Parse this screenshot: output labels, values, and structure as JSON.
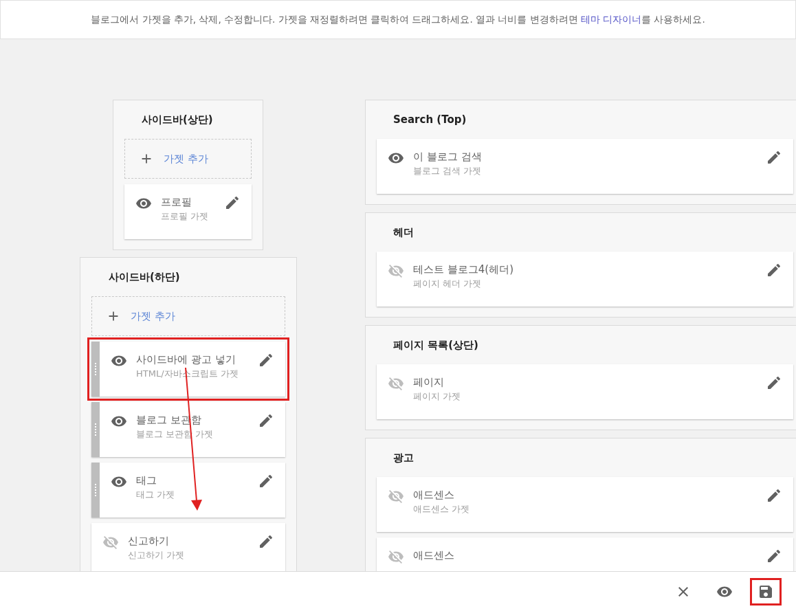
{
  "notice": {
    "before": "블로그에서 가젯을 추가, 삭제, 수정합니다. 가젯을 재정렬하려면 클릭하여 드래그하세요. 열과 너비를 변경하려면 ",
    "link": "테마 디자이너",
    "after": "를 사용하세요."
  },
  "left_column": [
    {
      "title": "사이드바(상단)",
      "add_label": "가젯 추가",
      "gadgets": [
        {
          "title": "프로필",
          "subtitle": "프로필 가젯",
          "visible": true,
          "draggable": false,
          "highlighted": false
        }
      ]
    },
    {
      "title": "사이드바(하단)",
      "add_label": "가젯 추가",
      "gadgets": [
        {
          "title": "사이드바에 광고 넣기",
          "subtitle": "HTML/자바스크립트 가젯",
          "visible": true,
          "draggable": true,
          "highlighted": true
        },
        {
          "title": "블로그 보관함",
          "subtitle": "블로그 보관함 가젯",
          "visible": true,
          "draggable": true,
          "highlighted": false
        },
        {
          "title": "태그",
          "subtitle": "태그 가젯",
          "visible": true,
          "draggable": true,
          "highlighted": false
        },
        {
          "title": "신고하기",
          "subtitle": "신고하기 가젯",
          "visible": false,
          "draggable": false,
          "highlighted": false
        }
      ]
    }
  ],
  "right_column": [
    {
      "title": "Search (Top)",
      "gadgets": [
        {
          "title": "이 블로그 검색",
          "subtitle": "블로그 검색 가젯",
          "visible": true,
          "draggable": false,
          "highlighted": false
        }
      ]
    },
    {
      "title": "헤더",
      "gadgets": [
        {
          "title": "테스트 블로그4(헤더)",
          "subtitle": "페이지 헤더 가젯",
          "visible": false,
          "draggable": false,
          "highlighted": false
        }
      ]
    },
    {
      "title": "페이지 목록(상단)",
      "gadgets": [
        {
          "title": "페이지",
          "subtitle": "페이지 가젯",
          "visible": false,
          "draggable": false,
          "highlighted": false
        }
      ]
    },
    {
      "title": "광고",
      "gadgets": [
        {
          "title": "애드센스",
          "subtitle": "애드센스 가젯",
          "visible": false,
          "draggable": false,
          "highlighted": false
        },
        {
          "title": "애드센스",
          "visible": false,
          "draggable": false,
          "highlighted": false
        }
      ]
    }
  ],
  "footer": {
    "buttons": [
      {
        "kind": "close",
        "highlighted": false
      },
      {
        "kind": "preview",
        "highlighted": false
      },
      {
        "kind": "save",
        "highlighted": true
      }
    ]
  }
}
